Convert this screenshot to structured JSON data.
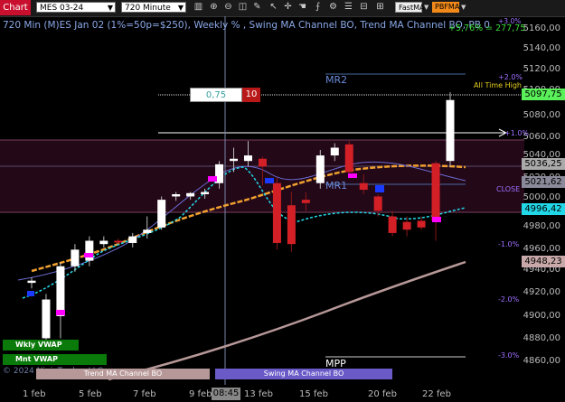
{
  "toolbar": {
    "chart_tab": "Chart",
    "symbol": "MES 03-24",
    "timeframe": "720 Minute",
    "indicator_fast": "FastMA",
    "indicator_pbf": "PBFMA"
  },
  "chart": {
    "title": "720 Min (M)ES Jan 02 (1%=50p=$250), Weekly % , Swing MA Channel BO, Trend MA Channel BO, PB 0",
    "top_pct": "+3.0%",
    "header_gain": "+5,76% = 277,75",
    "crosshair_time": "08:45",
    "labels": {
      "mr2": "MR2",
      "mr1": "MR1",
      "mpp": "MPP",
      "all_time_high": "All Time High",
      "close": "CLOSE",
      "wkly_vwap": "Wkly VWAP",
      "mnt_vwap": "Mnt VWAP",
      "trend_ma": "Trend MA Channel BO",
      "swing_ma": "Swing MA Channel BO",
      "copyright": "© 2024 NinjaTrader, LLC"
    },
    "order": {
      "price": "0,75",
      "qty": "10"
    },
    "pct_levels": [
      "+3.0%",
      "+2.0%",
      "+1.0%",
      "-1.0%",
      "-2.0%",
      "-3.0%"
    ],
    "y_ticks": [
      "5160,00",
      "5140,00",
      "5120,00",
      "5100,00",
      "5080,00",
      "5060,00",
      "5040,00",
      "5020,00",
      "5000,00",
      "4980,00",
      "4960,00",
      "4940,00",
      "4920,00",
      "4900,00",
      "4880,00",
      "4860,00"
    ],
    "x_ticks": [
      "1 feb",
      "5 feb",
      "7 feb",
      "9 feb",
      "13 feb",
      "15 feb",
      "20 feb",
      "22 feb"
    ],
    "price_tags": {
      "last": "5097,75",
      "close": "5036,25",
      "ma_fast": "5021,62",
      "vwap": "4996,42",
      "ma_slow": "4948,23"
    },
    "colors": {
      "up_candle": "#ffffff",
      "down_candle": "#d32027",
      "ma_orange": "#f0a030",
      "ma_cyan": "#22d8e8",
      "ma_pink": "#b79898",
      "band_fill": "#2a0a1e"
    }
  },
  "chart_data": {
    "type": "candlestick",
    "y_range": [
      4850,
      5170
    ],
    "candles": [
      {
        "o": 4930,
        "h": 4935,
        "l": 4925,
        "c": 4932
      },
      {
        "o": 4880,
        "h": 4920,
        "l": 4878,
        "c": 4915
      },
      {
        "o": 4900,
        "h": 4948,
        "l": 4880,
        "c": 4945
      },
      {
        "o": 4945,
        "h": 4965,
        "l": 4940,
        "c": 4960
      },
      {
        "o": 4950,
        "h": 4972,
        "l": 4945,
        "c": 4968
      },
      {
        "o": 4965,
        "h": 4972,
        "l": 4962,
        "c": 4968
      },
      {
        "o": 4968,
        "h": 4970,
        "l": 4965,
        "c": 4967
      },
      {
        "o": 4966,
        "h": 4975,
        "l": 4962,
        "c": 4972
      },
      {
        "o": 4975,
        "h": 4990,
        "l": 4970,
        "c": 4978
      },
      {
        "o": 4980,
        "h": 5008,
        "l": 4978,
        "c": 5005
      },
      {
        "o": 5008,
        "h": 5012,
        "l": 5004,
        "c": 5010
      },
      {
        "o": 5008,
        "h": 5012,
        "l": 5005,
        "c": 5011
      },
      {
        "o": 5010,
        "h": 5015,
        "l": 5006,
        "c": 5012
      },
      {
        "o": 5020,
        "h": 5040,
        "l": 5015,
        "c": 5037
      },
      {
        "o": 5040,
        "h": 5052,
        "l": 5030,
        "c": 5042
      },
      {
        "o": 5040,
        "h": 5058,
        "l": 5035,
        "c": 5045
      },
      {
        "o": 5042,
        "h": 5044,
        "l": 5018,
        "c": 5035
      },
      {
        "o": 5020,
        "h": 5025,
        "l": 4960,
        "c": 4966
      },
      {
        "o": 5000,
        "h": 5012,
        "l": 4958,
        "c": 4965
      },
      {
        "o": 5005,
        "h": 5012,
        "l": 4995,
        "c": 5002
      },
      {
        "o": 5020,
        "h": 5050,
        "l": 5015,
        "c": 5045
      },
      {
        "o": 5045,
        "h": 5056,
        "l": 5040,
        "c": 5052
      },
      {
        "o": 5055,
        "h": 5058,
        "l": 5025,
        "c": 5030
      },
      {
        "o": 5020,
        "h": 5028,
        "l": 5010,
        "c": 5014
      },
      {
        "o": 5008,
        "h": 5010,
        "l": 4990,
        "c": 4995
      },
      {
        "o": 4990,
        "h": 4995,
        "l": 4972,
        "c": 4975
      },
      {
        "o": 4985,
        "h": 4990,
        "l": 4972,
        "c": 4978
      },
      {
        "o": 4986,
        "h": 4990,
        "l": 4978,
        "c": 4980
      },
      {
        "o": 5038,
        "h": 5040,
        "l": 4968,
        "c": 4986
      },
      {
        "o": 5040,
        "h": 5102,
        "l": 5035,
        "c": 5095
      }
    ]
  }
}
